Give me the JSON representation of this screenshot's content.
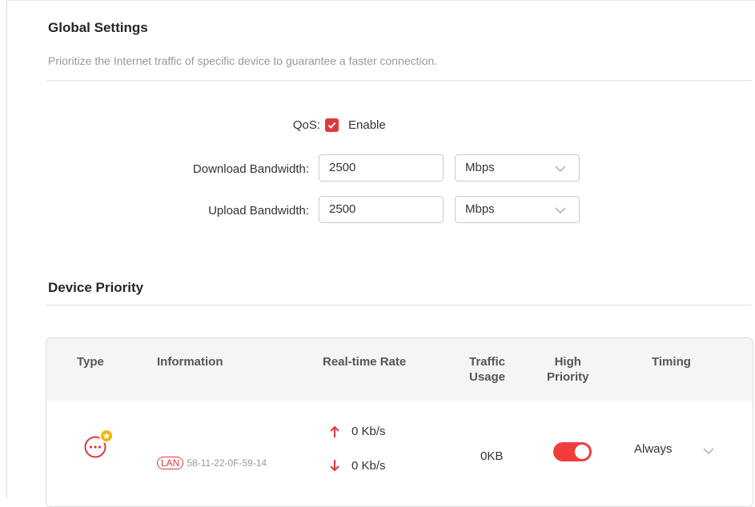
{
  "global": {
    "title": "Global Settings",
    "description": "Prioritize the Internet traffic of specific device to guarantee a faster connection."
  },
  "qos": {
    "label": "QoS:",
    "checked": true,
    "enable_label": "Enable"
  },
  "download": {
    "label": "Download Bandwidth:",
    "value": "2500",
    "unit": "Mbps"
  },
  "upload": {
    "label": "Upload Bandwidth:",
    "value": "2500",
    "unit": "Mbps"
  },
  "device_priority": {
    "title": "Device Priority",
    "columns": {
      "type": "Type",
      "information": "Information",
      "rate": "Real-time Rate",
      "traffic_line1": "Traffic",
      "traffic_line2": "Usage",
      "priority_line1": "High",
      "priority_line2": "Priority",
      "timing": "Timing"
    },
    "rows": [
      {
        "type_icon": "other-device-icon",
        "badge": "LAN",
        "mac": "58-11-22-0F-59-14",
        "upload_rate": "0 Kb/s",
        "download_rate": "0 Kb/s",
        "traffic": "0KB",
        "high_priority": true,
        "timing": "Always"
      }
    ]
  },
  "colors": {
    "accent": "#e0383e",
    "toggle_on": "#f03c3c",
    "table_header_bg": "#f5f5f5"
  }
}
